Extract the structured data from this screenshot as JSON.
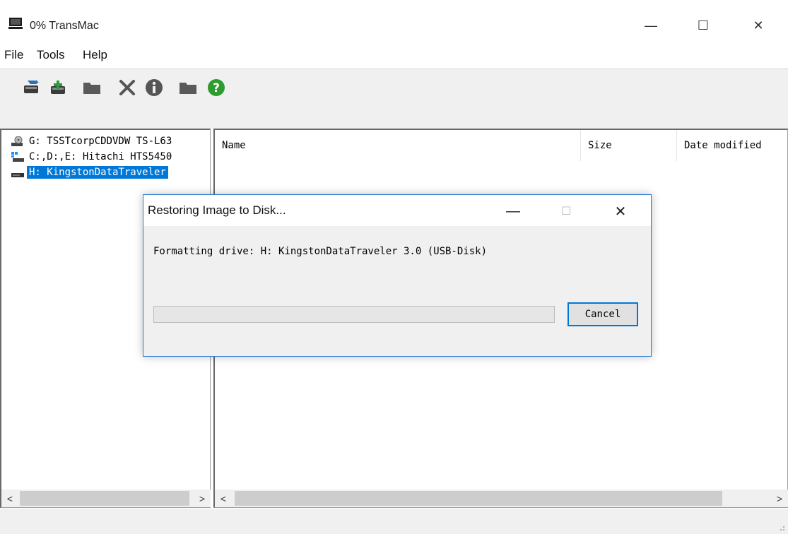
{
  "window": {
    "title": "0% TransMac",
    "minimize_glyph": "—",
    "maximize_glyph": "☐",
    "close_glyph": "✕"
  },
  "menu": {
    "items": [
      "File",
      "Tools",
      "Help"
    ]
  },
  "toolbar": {
    "icons": [
      "open-disk-icon",
      "add-disk-icon",
      "folder-icon",
      "delete-icon",
      "info-icon",
      "new-folder-icon",
      "help-icon"
    ]
  },
  "drives": [
    {
      "label": "G: TSSTcorpCDDVDW TS-L63",
      "icon": "optical-drive-icon",
      "selected": false
    },
    {
      "label": "C:,D:,E: Hitachi HTS5450",
      "icon": "windows-drive-icon",
      "selected": false
    },
    {
      "label": "H: KingstonDataTraveler",
      "icon": "usb-drive-icon",
      "selected": true
    }
  ],
  "file_list": {
    "columns": [
      "Name",
      "Size",
      "Date modified"
    ]
  },
  "scroll": {
    "left_arrow": "<",
    "right_arrow": ">"
  },
  "dialog": {
    "title": "Restoring Image to Disk...",
    "minimize_glyph": "—",
    "maximize_glyph": "☐",
    "close_glyph": "✕",
    "message": "Formatting drive: H: KingstonDataTraveler 3.0 (USB-Disk)",
    "progress": 0,
    "cancel_label": "Cancel"
  },
  "colors": {
    "selection": "#0078d7",
    "dialog_border": "#2c7bd4",
    "help_icon_green": "#2e9c2e"
  }
}
